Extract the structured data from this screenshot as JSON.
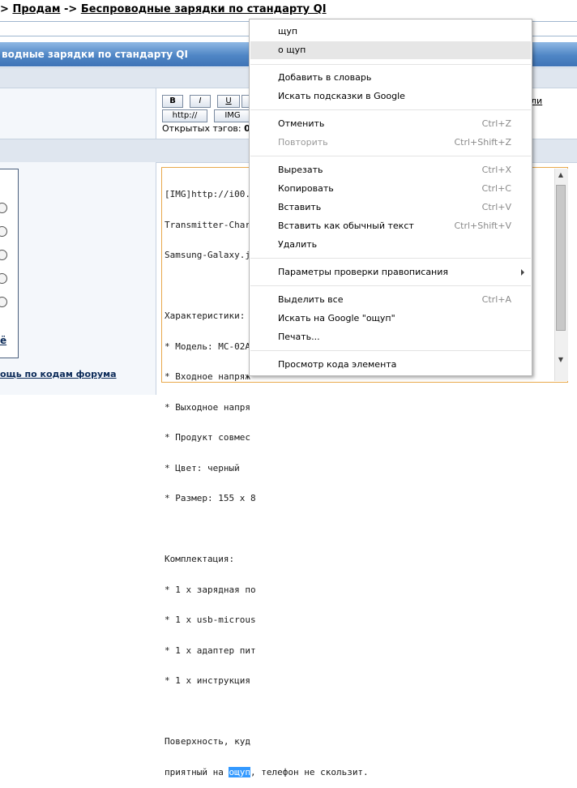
{
  "breadcrumb": {
    "prefix": ">",
    "section": "Продам",
    "arrow": "->",
    "topic": "Беспроводные зарядки по стандарту QI"
  },
  "title_bar": "водные зарядки по стандарту QI",
  "toolbar": {
    "bold": "B",
    "italic": "I",
    "underline": "U",
    "http": "http://",
    "img": "IMG",
    "right_link": "ли",
    "open_tags_label": "Открытых тэгов:",
    "open_tags_count": "0"
  },
  "emoticons": {
    "more_link": "ё",
    "help_link": "ощь по кодам форума"
  },
  "editor": {
    "lines": [
      "[IMG]http://i00.i.a",
      "Transmitter-Charg",
      "Samsung-Galaxy.j",
      "",
      "Характеристики:",
      "* Модель: MC-02A",
      "* Входное напряж",
      "* Выходное напря",
      "* Продукт совмес",
      "* Цвет: черный",
      "* Размер: 155 x 8",
      "",
      "Комплектация:",
      "* 1 x зарядная по",
      "* 1 x usb-microus",
      "* 1 x адаптер пит",
      "* 1 x инструкция",
      "",
      "Поверхность, куд"
    ],
    "last_line_before": "приятный на ",
    "selected_word": "ощуп",
    "last_line_after": ", телефон не скользит."
  },
  "context_menu": {
    "suggestions": [
      "щуп",
      "о щуп"
    ],
    "add_to_dictionary": "Добавить в словарь",
    "search_hints": "Искать подсказки в Google",
    "undo": "Отменить",
    "undo_shortcut": "Ctrl+Z",
    "redo": "Повторить",
    "redo_shortcut": "Ctrl+Shift+Z",
    "cut": "Вырезать",
    "cut_shortcut": "Ctrl+X",
    "copy": "Копировать",
    "copy_shortcut": "Ctrl+C",
    "paste": "Вставить",
    "paste_shortcut": "Ctrl+V",
    "paste_plain": "Вставить как обычный текст",
    "paste_plain_shortcut": "Ctrl+Shift+V",
    "delete": "Удалить",
    "spellcheck_options": "Параметры проверки правописания",
    "select_all": "Выделить все",
    "select_all_shortcut": "Ctrl+A",
    "search_google": "Искать на Google \"ощуп\"",
    "print": "Печать...",
    "inspect": "Просмотр кода элемента"
  },
  "colors": {
    "title_bar": "#4f86c5",
    "textarea_border": "#e8a84b",
    "selection": "#3399ff"
  }
}
